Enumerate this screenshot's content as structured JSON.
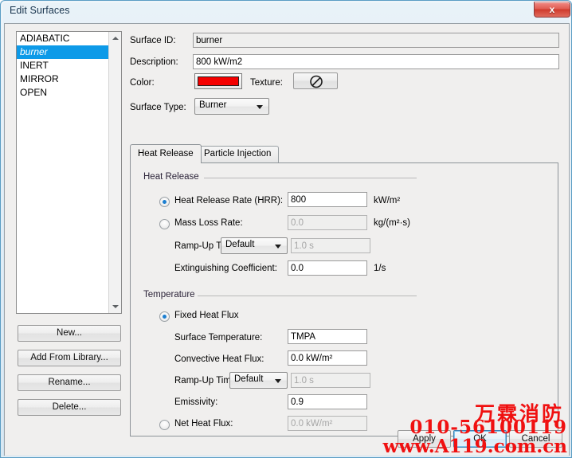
{
  "window": {
    "title": "Edit Surfaces",
    "close_label": "x"
  },
  "surface_list": {
    "items": [
      {
        "label": "ADIABATIC",
        "selected": false
      },
      {
        "label": "burner",
        "selected": true
      },
      {
        "label": "INERT",
        "selected": false
      },
      {
        "label": "MIRROR",
        "selected": false
      },
      {
        "label": "OPEN",
        "selected": false
      }
    ]
  },
  "side_buttons": [
    {
      "label": "New..."
    },
    {
      "label": "Add From Library..."
    },
    {
      "label": "Rename..."
    },
    {
      "label": "Delete..."
    }
  ],
  "surface": {
    "id_label": "Surface ID:",
    "id_value": "burner",
    "description_label": "Description:",
    "description_value": "800 kW/m2",
    "color_label": "Color:",
    "color_value": "#f40000",
    "texture_label": "Texture:",
    "texture_icon": "no-texture-icon",
    "type_label": "Surface Type:",
    "type_value": "Burner"
  },
  "tabs": [
    {
      "label": "Heat Release",
      "active": true
    },
    {
      "label": "Particle Injection",
      "active": false
    }
  ],
  "heat_release": {
    "group_label": "Heat Release",
    "hrr_label": "Heat Release Rate (HRR):",
    "hrr_value": "800",
    "hrr_unit": "kW/m²",
    "hrr_selected": true,
    "mlr_label": "Mass Loss Rate:",
    "mlr_value": "0.0",
    "mlr_unit": "kg/(m²·s)",
    "mlr_selected": false,
    "ramp_label": "Ramp-Up Time:",
    "ramp_value": "Default",
    "ramp_time": "1.0 s",
    "exting_label": "Extinguishing Coefficient:",
    "exting_value": "0.0",
    "exting_unit": "1/s"
  },
  "temperature": {
    "group_label": "Temperature",
    "fixed_label": "Fixed Heat Flux",
    "fixed_selected": true,
    "surface_temp_label": "Surface Temperature:",
    "surface_temp_value": "TMPA",
    "conv_flux_label": "Convective Heat Flux:",
    "conv_flux_value": "0.0 kW/m²",
    "ramp_label": "Ramp-Up Time:",
    "ramp_value": "Default",
    "ramp_time": "1.0 s",
    "emissivity_label": "Emissivity:",
    "emissivity_value": "0.9",
    "net_flux_label": "Net Heat Flux:",
    "net_flux_value": "0.0 kW/m²",
    "net_flux_selected": false
  },
  "dialog_buttons": {
    "apply": "Apply",
    "ok": "OK",
    "cancel": "Cancel"
  },
  "watermark": {
    "company": "万霖消防",
    "phone": "010-56100119",
    "url": "www.A119.com.cn",
    "color": "#f01010"
  }
}
